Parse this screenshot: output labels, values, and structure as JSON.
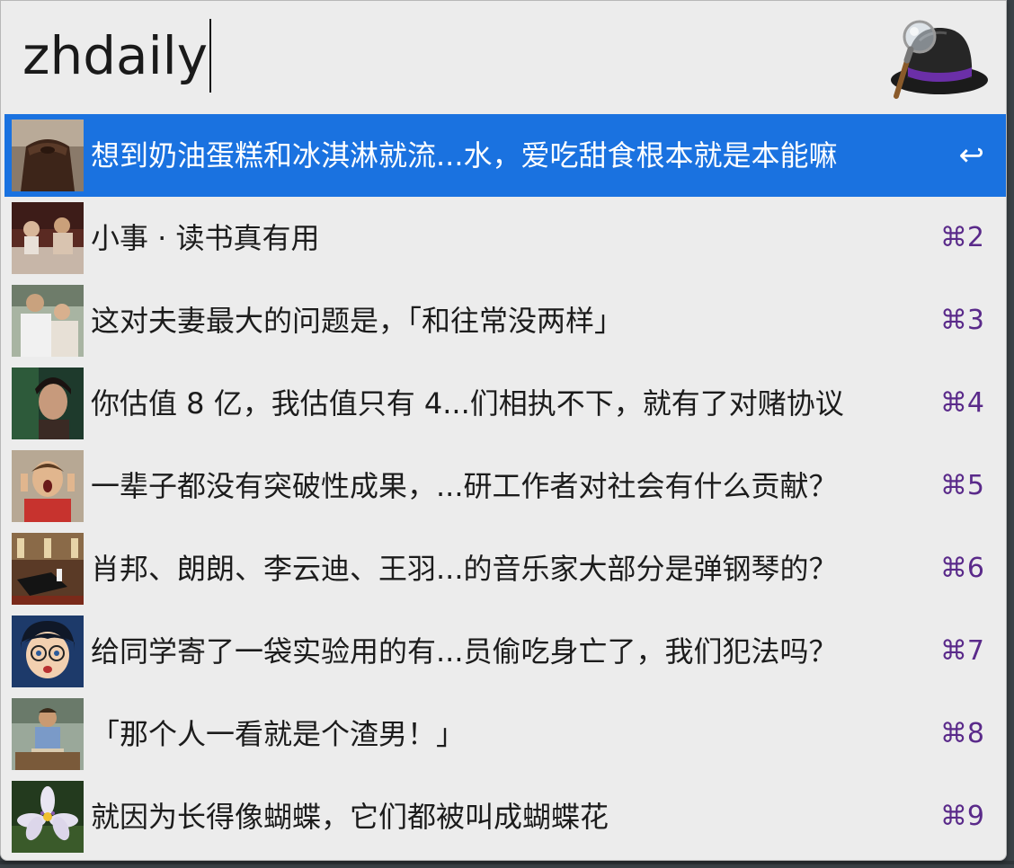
{
  "search": {
    "query": "zhdaily"
  },
  "logo": {
    "icon": "alfred-hat-icon"
  },
  "colors": {
    "selected_bg": "#1a72e0",
    "shortcut_text": "#5a2a8a",
    "window_bg": "#ececec"
  },
  "results": [
    {
      "title": "想到奶油蛋糕和冰淇淋就流...水，爱吃甜食根本就是本能嘛",
      "shortcut": "↩",
      "thumb": "chocolate-cake-thumbnail"
    },
    {
      "title": "小事 · 读书真有用",
      "shortcut": "⌘2",
      "thumb": "bathtub-reading-thumbnail"
    },
    {
      "title": "这对夫妻最大的问题是，「和往常没两样」",
      "shortcut": "⌘3",
      "thumb": "couple-thumbnail"
    },
    {
      "title": "你估值 8 亿，我估值只有 4...们相执不下，就有了对赌协议",
      "shortcut": "⌘4",
      "thumb": "woman-portrait-thumbnail"
    },
    {
      "title": "一辈子都没有突破性成果，...研工作者对社会有什么贡献？",
      "shortcut": "⌘5",
      "thumb": "man-screaming-thumbnail"
    },
    {
      "title": "肖邦、朗朗、李云迪、王羽...的音乐家大部分是弹钢琴的？",
      "shortcut": "⌘6",
      "thumb": "piano-hall-thumbnail"
    },
    {
      "title": "给同学寄了一袋实验用的有...员偷吃身亡了，我们犯法吗？",
      "shortcut": "⌘7",
      "thumb": "anime-boy-thumbnail"
    },
    {
      "title": "「那个人一看就是个渣男！」",
      "shortcut": "⌘8",
      "thumb": "man-sitting-thumbnail"
    },
    {
      "title": "就因为长得像蝴蝶，它们都被叫成蝴蝶花",
      "shortcut": "⌘9",
      "thumb": "iris-flower-thumbnail"
    }
  ]
}
